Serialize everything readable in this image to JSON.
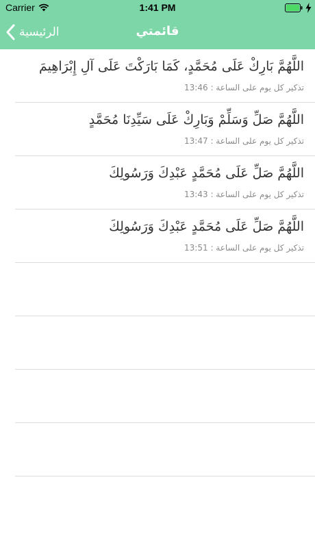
{
  "status_bar": {
    "carrier": "Carrier",
    "time": "1:41 PM",
    "battery_color": "#4cd964"
  },
  "nav": {
    "back_label": "الرئيسية",
    "title": "قائمتي",
    "header_color": "#7dd6a8"
  },
  "reminders": [
    {
      "text": "اللَّهُمَّ بَارِكْ عَلَى مُحَمَّدٍ، كَمَا بَارَكْتَ عَلَى آلِ إِبْرَاهِيمَ",
      "schedule": "تذكير كل يوم على الساعة : 13:46"
    },
    {
      "text": "اللَّهُمَّ صَلِّ وَسَلِّمْ وَبَارِكْ عَلَى سَيِّدِنَا مُحَمَّدٍ",
      "schedule": "تذكير كل يوم على الساعة : 13:47"
    },
    {
      "text": "اللَّهُمَّ صَلِّ عَلَى مُحَمَّدٍ عَبْدِكَ وَرَسُولِكَ",
      "schedule": "تذكير كل يوم على الساعة : 13:43"
    },
    {
      "text": "اللَّهُمَّ صَلِّ عَلَى مُحَمَّدٍ عَبْدِكَ وَرَسُولِكَ",
      "schedule": "تذكير كل يوم على الساعة : 13:51"
    }
  ]
}
